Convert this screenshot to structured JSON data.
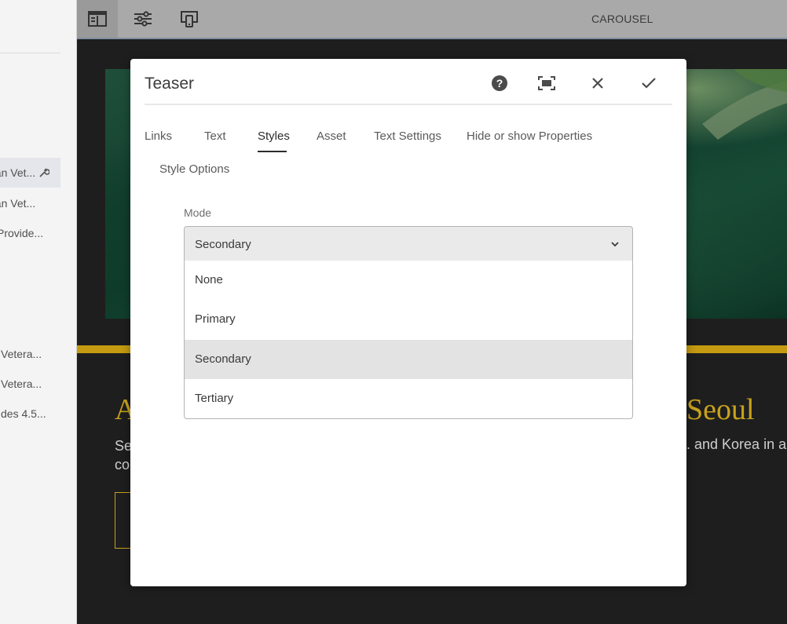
{
  "left_panel": {
    "items": [
      {
        "label": "ean Vet..."
      },
      {
        "label": "ean Vet..."
      },
      {
        "label": "Provide..."
      },
      {
        "label": "Vetera..."
      },
      {
        "label": "Vetera..."
      },
      {
        "label": "des 4.5..."
      }
    ]
  },
  "toolbar": {
    "title": "CAROUSEL",
    "buttons": [
      {
        "icon": "toggle-side-panel-icon"
      },
      {
        "icon": "properties-icon"
      },
      {
        "icon": "emulator-icon"
      }
    ]
  },
  "page": {
    "headline_left": "A",
    "headline_right": "Seoul",
    "body_left_line1": "Se",
    "body_left_line2": "co",
    "body_right": ". and Korea in a"
  },
  "dialog": {
    "title": "Teaser",
    "actions": [
      {
        "icon": "help-icon"
      },
      {
        "icon": "fullscreen-icon"
      },
      {
        "icon": "close-icon"
      },
      {
        "icon": "checkmark-icon"
      }
    ],
    "tabs": [
      "Links",
      "Text",
      "Styles",
      "Asset",
      "Text Settings",
      "Hide or show Properties"
    ],
    "active_tab": "Styles",
    "subtab": "Style Options",
    "field": {
      "label": "Mode",
      "value": "Secondary",
      "options": [
        "None",
        "Primary",
        "Secondary",
        "Tertiary"
      ]
    }
  },
  "colors": {
    "accent_gold": "#c49a10",
    "toolbar_bg": "#a9a9a9",
    "dialog_bg": "#ffffff"
  }
}
